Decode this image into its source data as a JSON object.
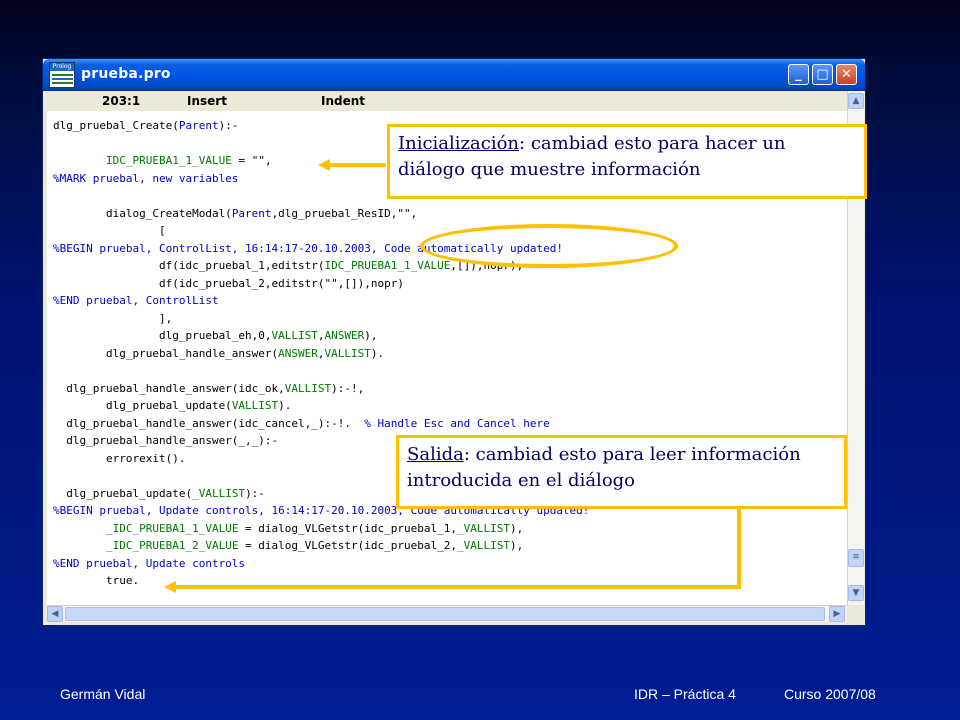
{
  "window": {
    "title": "prueba.pro",
    "app_icon_label": "Prolog",
    "buttons": {
      "minimize": "_",
      "maximize": "□",
      "close": "✕"
    },
    "status": {
      "position": "203:1",
      "mode": "Insert",
      "indent": "Indent"
    }
  },
  "code_lines": [
    [
      {
        "t": "dlg_pruebal_Create(",
        "c": ""
      },
      {
        "t": "Parent",
        "c": "blue"
      },
      {
        "t": "):-",
        "c": ""
      }
    ],
    [],
    [
      {
        "t": "        ",
        "c": ""
      },
      {
        "t": "IDC_PRUEBA1_1_VALUE",
        "c": "green"
      },
      {
        "t": " = \"\",",
        "c": ""
      }
    ],
    [
      {
        "t": "%MARK pruebal, new variables",
        "c": "blue"
      }
    ],
    [],
    [
      {
        "t": "        dialog_CreateModal(",
        "c": ""
      },
      {
        "t": "Parent",
        "c": "blue"
      },
      {
        "t": ",dlg_pruebal_ResID,\"\",",
        "c": ""
      }
    ],
    [
      {
        "t": "                [",
        "c": ""
      }
    ],
    [
      {
        "t": "%BEGIN pruebal, ControlList, 16:14:17-20.10.2003, Code automatically updated!",
        "c": "blue"
      }
    ],
    [
      {
        "t": "                df(idc_pruebal_1,editstr(",
        "c": ""
      },
      {
        "t": "IDC_PRUEBA1_1_VALUE",
        "c": "green"
      },
      {
        "t": ",[]),nopr),",
        "c": ""
      }
    ],
    [
      {
        "t": "                df(idc_pruebal_2,editstr(\"\",[]),nopr)",
        "c": ""
      }
    ],
    [
      {
        "t": "%END pruebal, ControlList",
        "c": "blue"
      }
    ],
    [
      {
        "t": "                ],",
        "c": ""
      }
    ],
    [
      {
        "t": "                dlg_pruebal_eh,0,",
        "c": ""
      },
      {
        "t": "VALLIST",
        "c": "green"
      },
      {
        "t": ",",
        "c": ""
      },
      {
        "t": "ANSWER",
        "c": "green"
      },
      {
        "t": "),",
        "c": ""
      }
    ],
    [
      {
        "t": "        dlg_pruebal_handle_answer(",
        "c": ""
      },
      {
        "t": "ANSWER",
        "c": "green"
      },
      {
        "t": ",",
        "c": ""
      },
      {
        "t": "VALLIST",
        "c": "green"
      },
      {
        "t": ").",
        "c": ""
      }
    ],
    [],
    [
      {
        "t": "  dlg_pruebal_handle_answer(idc_ok,",
        "c": ""
      },
      {
        "t": "VALLIST",
        "c": "green"
      },
      {
        "t": "):-!,",
        "c": ""
      }
    ],
    [
      {
        "t": "        dlg_pruebal_update(",
        "c": ""
      },
      {
        "t": "VALLIST",
        "c": "green"
      },
      {
        "t": ").",
        "c": ""
      }
    ],
    [
      {
        "t": "  dlg_pruebal_handle_answer(idc_cancel,_):-!.  ",
        "c": ""
      },
      {
        "t": "% Handle Esc and Cancel here",
        "c": "blue"
      }
    ],
    [
      {
        "t": "  dlg_pruebal_handle_answer(_,_):-",
        "c": ""
      }
    ],
    [
      {
        "t": "        errorexit().",
        "c": ""
      }
    ],
    [],
    [
      {
        "t": "  dlg_pruebal_update(",
        "c": ""
      },
      {
        "t": "_VALLIST",
        "c": "green"
      },
      {
        "t": "):-",
        "c": ""
      }
    ],
    [
      {
        "t": "%BEGIN pruebal, Update controls, 16:14:17-20.10.2003, Code automatically updated!",
        "c": "blue"
      }
    ],
    [
      {
        "t": "        ",
        "c": ""
      },
      {
        "t": "_IDC_PRUEBA1_1_VALUE",
        "c": "green"
      },
      {
        "t": " = dialog_VLGetstr(idc_pruebal_1,",
        "c": ""
      },
      {
        "t": "_VALLIST",
        "c": "green"
      },
      {
        "t": "),",
        "c": ""
      }
    ],
    [
      {
        "t": "        ",
        "c": ""
      },
      {
        "t": "_IDC_PRUEBA1_2_VALUE",
        "c": "green"
      },
      {
        "t": " = dialog_VLGetstr(idc_pruebal_2,",
        "c": ""
      },
      {
        "t": "_VALLIST",
        "c": "green"
      },
      {
        "t": "),",
        "c": ""
      }
    ],
    [
      {
        "t": "%END pruebal, Update controls",
        "c": "blue"
      }
    ],
    [
      {
        "t": "        true.",
        "c": ""
      }
    ]
  ],
  "callouts": {
    "init": {
      "head": "Inicialización",
      "text": ": cambiad esto para hacer un diálogo que muestre información"
    },
    "salida": {
      "head": "Salida",
      "text": ": cambiad esto para leer información introducida en el diálogo"
    }
  },
  "footer": {
    "author": "Germán Vidal",
    "course": "IDR – Práctica 4",
    "year": "Curso 2007/08"
  },
  "colors": {
    "accent": "#ffc000",
    "code_blue": "#0000cc",
    "code_green": "#007a00",
    "text_navy": "#000066"
  }
}
